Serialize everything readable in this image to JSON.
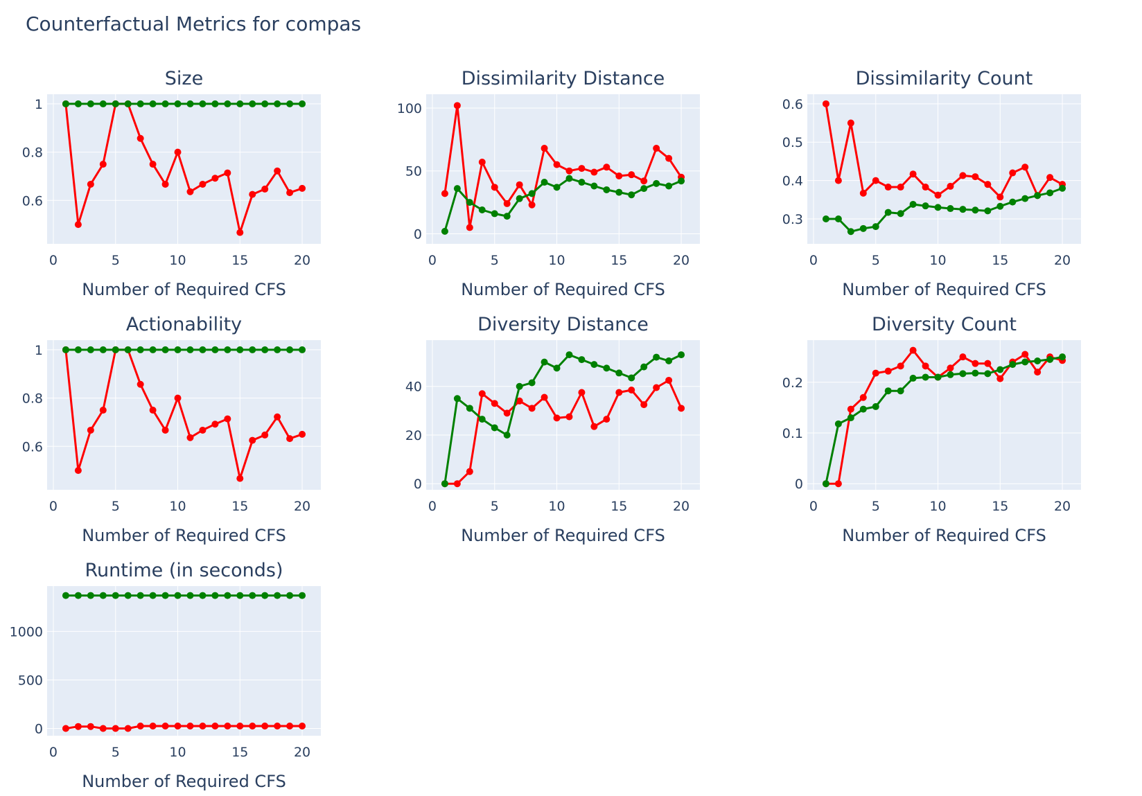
{
  "figure": {
    "title": "Counterfactual Metrics for compas"
  },
  "colors": {
    "plot_bg": "#e5ecf6",
    "grid": "#ffffff",
    "text": "#2a3f5f",
    "series_red": "#ff0000",
    "series_green": "#008000"
  },
  "chart_data": [
    {
      "type": "line",
      "title": "Size",
      "xlabel": "Number of Required CFS",
      "ylabel": "",
      "xlim": [
        -0.5,
        21.5
      ],
      "ylim": [
        0.42,
        1.04
      ],
      "xticks": [
        0,
        5,
        10,
        15,
        20
      ],
      "xtick_labels": [
        "0",
        "5",
        "10",
        "15",
        "20"
      ],
      "yticks": [
        0.6,
        0.8,
        1
      ],
      "ytick_labels": [
        "0.6",
        "0.8",
        "1"
      ],
      "x": [
        1,
        2,
        3,
        4,
        5,
        6,
        7,
        8,
        9,
        10,
        11,
        12,
        13,
        14,
        15,
        16,
        17,
        18,
        19,
        20
      ],
      "series": [
        {
          "color": "#ff0000",
          "values": [
            1,
            0.5,
            0.667,
            0.75,
            1,
            1,
            0.857,
            0.75,
            0.667,
            0.8,
            0.636,
            0.667,
            0.692,
            0.714,
            0.467,
            0.625,
            0.647,
            0.722,
            0.632,
            0.65
          ]
        },
        {
          "color": "#008000",
          "values": [
            1,
            1,
            1,
            1,
            1,
            1,
            1,
            1,
            1,
            1,
            1,
            1,
            1,
            1,
            1,
            1,
            1,
            1,
            1,
            1
          ]
        }
      ]
    },
    {
      "type": "line",
      "title": "Dissimilarity Distance",
      "xlabel": "Number of Required CFS",
      "ylabel": "",
      "xlim": [
        -0.5,
        21.5
      ],
      "ylim": [
        -8,
        111
      ],
      "xticks": [
        0,
        5,
        10,
        15,
        20
      ],
      "xtick_labels": [
        "0",
        "5",
        "10",
        "15",
        "20"
      ],
      "yticks": [
        0,
        50,
        100
      ],
      "ytick_labels": [
        "0",
        "50",
        "100"
      ],
      "x": [
        1,
        2,
        3,
        4,
        5,
        6,
        7,
        8,
        9,
        10,
        11,
        12,
        13,
        14,
        15,
        16,
        17,
        18,
        19,
        20
      ],
      "series": [
        {
          "color": "#ff0000",
          "values": [
            32,
            102,
            5,
            57,
            37,
            24,
            39,
            23,
            68,
            55,
            50,
            52,
            49,
            53,
            46,
            47,
            42,
            68,
            60,
            45
          ]
        },
        {
          "color": "#008000",
          "values": [
            2,
            36,
            25,
            19,
            16,
            14,
            28,
            32,
            41,
            37,
            44,
            41,
            38,
            35,
            33,
            31,
            36,
            40,
            38,
            42
          ]
        }
      ]
    },
    {
      "type": "line",
      "title": "Dissimilarity Count",
      "xlabel": "Number of Required CFS",
      "ylabel": "",
      "xlim": [
        -0.5,
        21.5
      ],
      "ylim": [
        0.235,
        0.625
      ],
      "xticks": [
        0,
        5,
        10,
        15,
        20
      ],
      "xtick_labels": [
        "0",
        "5",
        "10",
        "15",
        "20"
      ],
      "yticks": [
        0.3,
        0.4,
        0.5,
        0.6
      ],
      "ytick_labels": [
        "0.3",
        "0.4",
        "0.5",
        "0.6"
      ],
      "x": [
        1,
        2,
        3,
        4,
        5,
        6,
        7,
        8,
        9,
        10,
        11,
        12,
        13,
        14,
        15,
        16,
        17,
        18,
        19,
        20
      ],
      "series": [
        {
          "color": "#ff0000",
          "values": [
            0.6,
            0.4,
            0.55,
            0.367,
            0.4,
            0.383,
            0.383,
            0.417,
            0.383,
            0.362,
            0.385,
            0.413,
            0.41,
            0.39,
            0.357,
            0.42,
            0.435,
            0.361,
            0.408,
            0.39
          ]
        },
        {
          "color": "#008000",
          "values": [
            0.3,
            0.3,
            0.267,
            0.275,
            0.28,
            0.317,
            0.314,
            0.338,
            0.334,
            0.33,
            0.327,
            0.325,
            0.323,
            0.321,
            0.333,
            0.344,
            0.353,
            0.361,
            0.368,
            0.38
          ]
        }
      ]
    },
    {
      "type": "line",
      "title": "Actionability",
      "xlabel": "Number of Required CFS",
      "ylabel": "",
      "xlim": [
        -0.5,
        21.5
      ],
      "ylim": [
        0.42,
        1.04
      ],
      "xticks": [
        0,
        5,
        10,
        15,
        20
      ],
      "xtick_labels": [
        "0",
        "5",
        "10",
        "15",
        "20"
      ],
      "yticks": [
        0.6,
        0.8,
        1
      ],
      "ytick_labels": [
        "0.6",
        "0.8",
        "1"
      ],
      "x": [
        1,
        2,
        3,
        4,
        5,
        6,
        7,
        8,
        9,
        10,
        11,
        12,
        13,
        14,
        15,
        16,
        17,
        18,
        19,
        20
      ],
      "series": [
        {
          "color": "#ff0000",
          "values": [
            1,
            0.5,
            0.667,
            0.75,
            1,
            1,
            0.857,
            0.75,
            0.667,
            0.8,
            0.636,
            0.667,
            0.692,
            0.714,
            0.467,
            0.625,
            0.647,
            0.722,
            0.632,
            0.65
          ]
        },
        {
          "color": "#008000",
          "values": [
            1,
            1,
            1,
            1,
            1,
            1,
            1,
            1,
            1,
            1,
            1,
            1,
            1,
            1,
            1,
            1,
            1,
            1,
            1,
            1
          ]
        }
      ]
    },
    {
      "type": "line",
      "title": "Diversity Distance",
      "xlabel": "Number of Required CFS",
      "ylabel": "",
      "xlim": [
        -0.5,
        21.5
      ],
      "ylim": [
        -2.5,
        59
      ],
      "xticks": [
        0,
        5,
        10,
        15,
        20
      ],
      "xtick_labels": [
        "0",
        "5",
        "10",
        "15",
        "20"
      ],
      "yticks": [
        0,
        20,
        40
      ],
      "ytick_labels": [
        "0",
        "20",
        "40"
      ],
      "x": [
        1,
        2,
        3,
        4,
        5,
        6,
        7,
        8,
        9,
        10,
        11,
        12,
        13,
        14,
        15,
        16,
        17,
        18,
        19,
        20
      ],
      "series": [
        {
          "color": "#ff0000",
          "values": [
            0,
            0,
            5,
            37,
            33,
            29,
            34,
            31,
            35.5,
            27,
            27.5,
            37.5,
            23.5,
            26.5,
            37.5,
            38.5,
            32.5,
            39.5,
            42.5,
            31
          ]
        },
        {
          "color": "#008000",
          "values": [
            0,
            35,
            31,
            26.5,
            23,
            20,
            40,
            41.5,
            50,
            47.5,
            53,
            51,
            49,
            47.5,
            45.5,
            43.5,
            48,
            52,
            50.5,
            53
          ]
        }
      ]
    },
    {
      "type": "line",
      "title": "Diversity Count",
      "xlabel": "Number of Required CFS",
      "ylabel": "",
      "xlim": [
        -0.5,
        21.5
      ],
      "ylim": [
        -0.012,
        0.283
      ],
      "xticks": [
        0,
        5,
        10,
        15,
        20
      ],
      "xtick_labels": [
        "0",
        "5",
        "10",
        "15",
        "20"
      ],
      "yticks": [
        0,
        0.1,
        0.2
      ],
      "ytick_labels": [
        "0",
        "0.1",
        "0.2"
      ],
      "x": [
        1,
        2,
        3,
        4,
        5,
        6,
        7,
        8,
        9,
        10,
        11,
        12,
        13,
        14,
        15,
        16,
        17,
        18,
        19,
        20
      ],
      "series": [
        {
          "color": "#ff0000",
          "values": [
            0,
            0,
            0.147,
            0.17,
            0.218,
            0.222,
            0.232,
            0.263,
            0.232,
            0.21,
            0.228,
            0.25,
            0.237,
            0.237,
            0.207,
            0.24,
            0.255,
            0.22,
            0.25,
            0.243
          ]
        },
        {
          "color": "#008000",
          "values": [
            0,
            0.118,
            0.13,
            0.147,
            0.152,
            0.183,
            0.183,
            0.208,
            0.21,
            0.21,
            0.215,
            0.217,
            0.218,
            0.217,
            0.225,
            0.235,
            0.24,
            0.242,
            0.245,
            0.25
          ]
        }
      ]
    },
    {
      "type": "line",
      "title": "Runtime (in seconds)",
      "xlabel": "Number of Required CFS",
      "ylabel": "",
      "xlim": [
        -0.5,
        21.5
      ],
      "ylim": [
        -75,
        1467
      ],
      "xticks": [
        0,
        5,
        10,
        15,
        20
      ],
      "xtick_labels": [
        "0",
        "5",
        "10",
        "15",
        "20"
      ],
      "yticks": [
        0,
        500,
        1000
      ],
      "ytick_labels": [
        "0",
        "500",
        "1000"
      ],
      "x": [
        1,
        2,
        3,
        4,
        5,
        6,
        7,
        8,
        9,
        10,
        11,
        12,
        13,
        14,
        15,
        16,
        17,
        18,
        19,
        20
      ],
      "series": [
        {
          "color": "#ff0000",
          "values": [
            0,
            20,
            20,
            0,
            0,
            0,
            25,
            25,
            25,
            25,
            25,
            25,
            25,
            25,
            25,
            25,
            25,
            25,
            25,
            25
          ]
        },
        {
          "color": "#008000",
          "values": [
            1370,
            1370,
            1370,
            1370,
            1370,
            1370,
            1370,
            1370,
            1370,
            1370,
            1370,
            1370,
            1370,
            1370,
            1370,
            1370,
            1370,
            1370,
            1370,
            1370
          ]
        }
      ]
    }
  ]
}
